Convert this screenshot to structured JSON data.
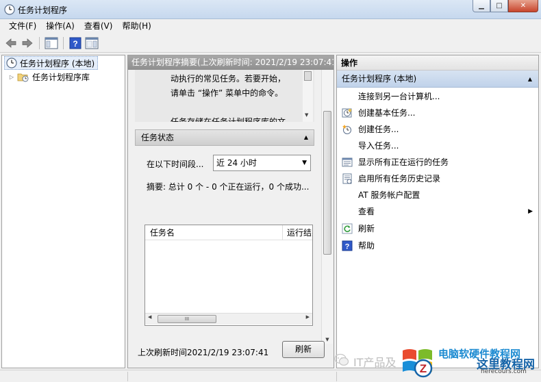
{
  "window": {
    "title": "任务计划程序",
    "minimize_glyph": "▁",
    "maximize_glyph": "□",
    "close_glyph": "✕"
  },
  "menu": [
    "文件(F)",
    "操作(A)",
    "查看(V)",
    "帮助(H)"
  ],
  "toolbar": {
    "icons": [
      "back-arrow-icon",
      "forward-arrow-icon",
      "show-hide-console-tree-icon",
      "help-icon",
      "show-action-pane-icon"
    ]
  },
  "tree": {
    "root": "任务计划程序 (本地)",
    "child": "任务计划程序库",
    "expander": "▷"
  },
  "middle": {
    "header": "任务计划程序摘要(上次刷新时间: 2021/2/19 23:07:41)",
    "description_lines": [
      "动执行的常见任务。若要开始，",
      "请单击 “操作” 菜单中的命令。",
      "",
      "任务存储在任务计划程序库的文"
    ],
    "status_section": {
      "title": "任务状态",
      "caret": "▲",
      "period_label": "在以下时间段...",
      "period_value": "近 24 小时",
      "summary": "摘要: 总计 0 个 - 0 个正在运行，0 个成功..."
    },
    "table": {
      "columns": [
        "任务名",
        "运行结果"
      ],
      "rows": [],
      "hscroll_grip": "III"
    },
    "last_refresh_label": "上次刷新时间2021/2/19 23:07:41",
    "refresh_button": "刷新"
  },
  "actions": {
    "header": "操作",
    "section": "任务计划程序 (本地)",
    "section_caret": "▲",
    "items": [
      {
        "label": "连接到另一台计算机...",
        "icon": "none"
      },
      {
        "label": "创建基本任务...",
        "icon": "create-basic-task-icon"
      },
      {
        "label": "创建任务...",
        "icon": "create-task-icon"
      },
      {
        "label": "导入任务...",
        "icon": "none"
      },
      {
        "label": "显示所有正在运行的任务",
        "icon": "running-tasks-icon"
      },
      {
        "label": "启用所有任务历史记录",
        "icon": "history-icon"
      },
      {
        "label": "AT 服务帐户配置",
        "icon": "none"
      },
      {
        "label": "查看",
        "icon": "none",
        "submenu": "▶"
      },
      {
        "label": "刷新",
        "icon": "refresh-icon"
      },
      {
        "label": "帮助",
        "icon": "help-icon"
      }
    ]
  },
  "watermark": {
    "text1": "IT产品及",
    "text2": "电脑软硬件教程网",
    "text3": "这里教程网",
    "text4": "herecours.com"
  }
}
